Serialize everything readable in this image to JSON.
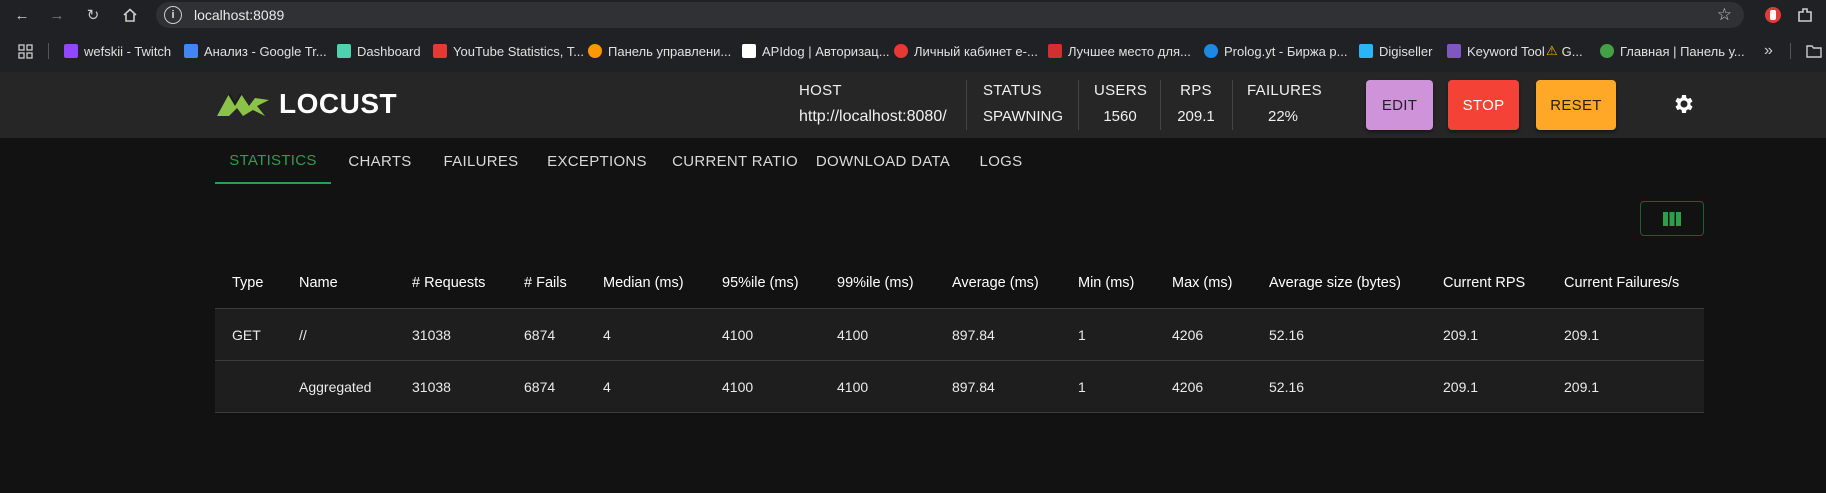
{
  "browser": {
    "url": "localhost:8089",
    "bookmarks": [
      {
        "label": "wefskii - Twitch",
        "color": "#9146ff"
      },
      {
        "label": "Анализ - Google Tr...",
        "color": "#4285f4"
      },
      {
        "label": "Dashboard",
        "color": "#4fd1b0"
      },
      {
        "label": "YouTube Statistics, T...",
        "color": "#e53935"
      },
      {
        "label": "Панель управлени...",
        "color": "#ff9800"
      },
      {
        "label": "APIdog | Авторизац...",
        "color": "#ffffff"
      },
      {
        "label": "Личный кабинет е-...",
        "color": "#e53935"
      },
      {
        "label": "Лучшее место для...",
        "color": "#d32f2f"
      },
      {
        "label": "Prolog.yt - Биржа р...",
        "color": "#1e88e5"
      },
      {
        "label": "Digiseller",
        "color": "#29b6f6"
      },
      {
        "label": "Keyword Tool",
        "color": "#7e57c2"
      },
      {
        "label": "G...",
        "color": "#ffb300"
      },
      {
        "label": "Главная | Панель у...",
        "color": "#43a047"
      }
    ]
  },
  "header": {
    "logo_text": "LOCUST",
    "host_label": "HOST",
    "host_value": "http://localhost:8080/",
    "status_label": "STATUS",
    "status_value": "SPAWNING",
    "users_label": "USERS",
    "users_value": "1560",
    "rps_label": "RPS",
    "rps_value": "209.1",
    "failures_label": "FAILURES",
    "failures_value": "22%",
    "edit_label": "EDIT",
    "stop_label": "STOP",
    "reset_label": "RESET",
    "colors": {
      "edit": "#ce93d8",
      "stop": "#f44336",
      "reset": "#ffa726",
      "accent": "#2e9e4d"
    }
  },
  "tabs": [
    "STATISTICS",
    "CHARTS",
    "FAILURES",
    "EXCEPTIONS",
    "CURRENT RATIO",
    "DOWNLOAD DATA",
    "LOGS"
  ],
  "table": {
    "columns": [
      "Type",
      "Name",
      "# Requests",
      "# Fails",
      "Median (ms)",
      "95%ile (ms)",
      "99%ile (ms)",
      "Average (ms)",
      "Min (ms)",
      "Max (ms)",
      "Average size (bytes)",
      "Current RPS",
      "Current Failures/s"
    ],
    "rows": [
      [
        "GET",
        "//",
        "31038",
        "6874",
        "4",
        "4100",
        "4100",
        "897.84",
        "1",
        "4206",
        "52.16",
        "209.1",
        "209.1"
      ],
      [
        "",
        "Aggregated",
        "31038",
        "6874",
        "4",
        "4100",
        "4100",
        "897.84",
        "1",
        "4206",
        "52.16",
        "209.1",
        "209.1"
      ]
    ]
  }
}
